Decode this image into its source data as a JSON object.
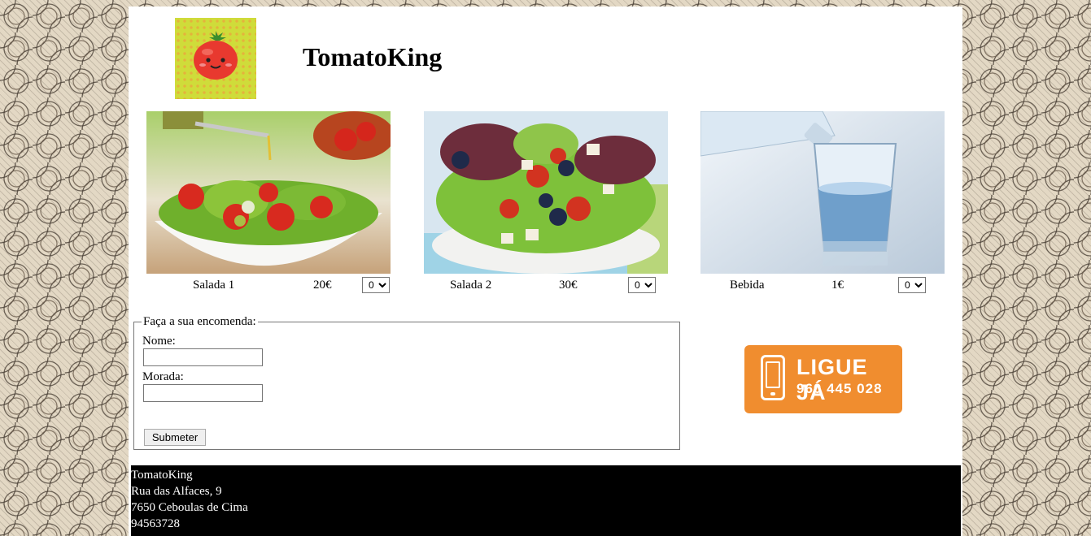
{
  "brand": {
    "title": "TomatoKing",
    "logo_icon": "tomato-logo-icon"
  },
  "products": [
    {
      "name": "Salada 1",
      "price": "20€",
      "quantity": "0",
      "image": "salad-bowl-photo"
    },
    {
      "name": "Salada 2",
      "price": "30€",
      "quantity": "0",
      "image": "greek-salad-photo"
    },
    {
      "name": "Bebida",
      "price": "1€",
      "quantity": "0",
      "image": "water-glass-photo"
    }
  ],
  "order_form": {
    "legend": "Faça a sua encomenda:",
    "name_label": "Nome:",
    "name_value": "",
    "address_label": "Morada:",
    "address_value": "",
    "submit_label": "Submeter"
  },
  "call_banner": {
    "label": "LIGUE JÁ",
    "number": "960 445 028",
    "icon": "phone-icon",
    "color": "#f08d2f"
  },
  "footer": {
    "name": "TomatoKing",
    "street": "Rua das Alfaces, 9",
    "city": "7650 Ceboulas de Cima",
    "phone": "94563728"
  }
}
